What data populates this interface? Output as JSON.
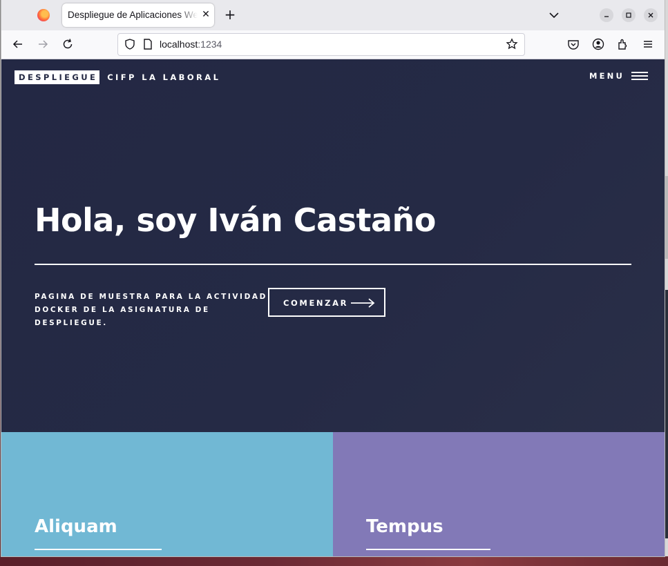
{
  "browser": {
    "tab_title": "Despliegue de Aplicaciones Web",
    "url_host": "localhost",
    "url_port": ":1234"
  },
  "header": {
    "brand": "DESPLIEGUE",
    "brand_sub": "CIFP LA LABORAL",
    "menu_label": "MENU"
  },
  "hero": {
    "title": "Hola, soy Iván Castaño",
    "description_line1": "PAGINA DE MUESTRA PARA LA ACTIVIDAD",
    "description_line2": "DOCKER DE LA ASIGNATURA DE DESPLIEGUE.",
    "cta_label": "COMENZAR"
  },
  "tiles": [
    {
      "title": "Aliquam",
      "color": "#71b8d4"
    },
    {
      "title": "Tempus",
      "color": "#8279b7"
    }
  ],
  "colors": {
    "page_bg": "#242943",
    "chrome_bg": "#e9e9ed"
  }
}
